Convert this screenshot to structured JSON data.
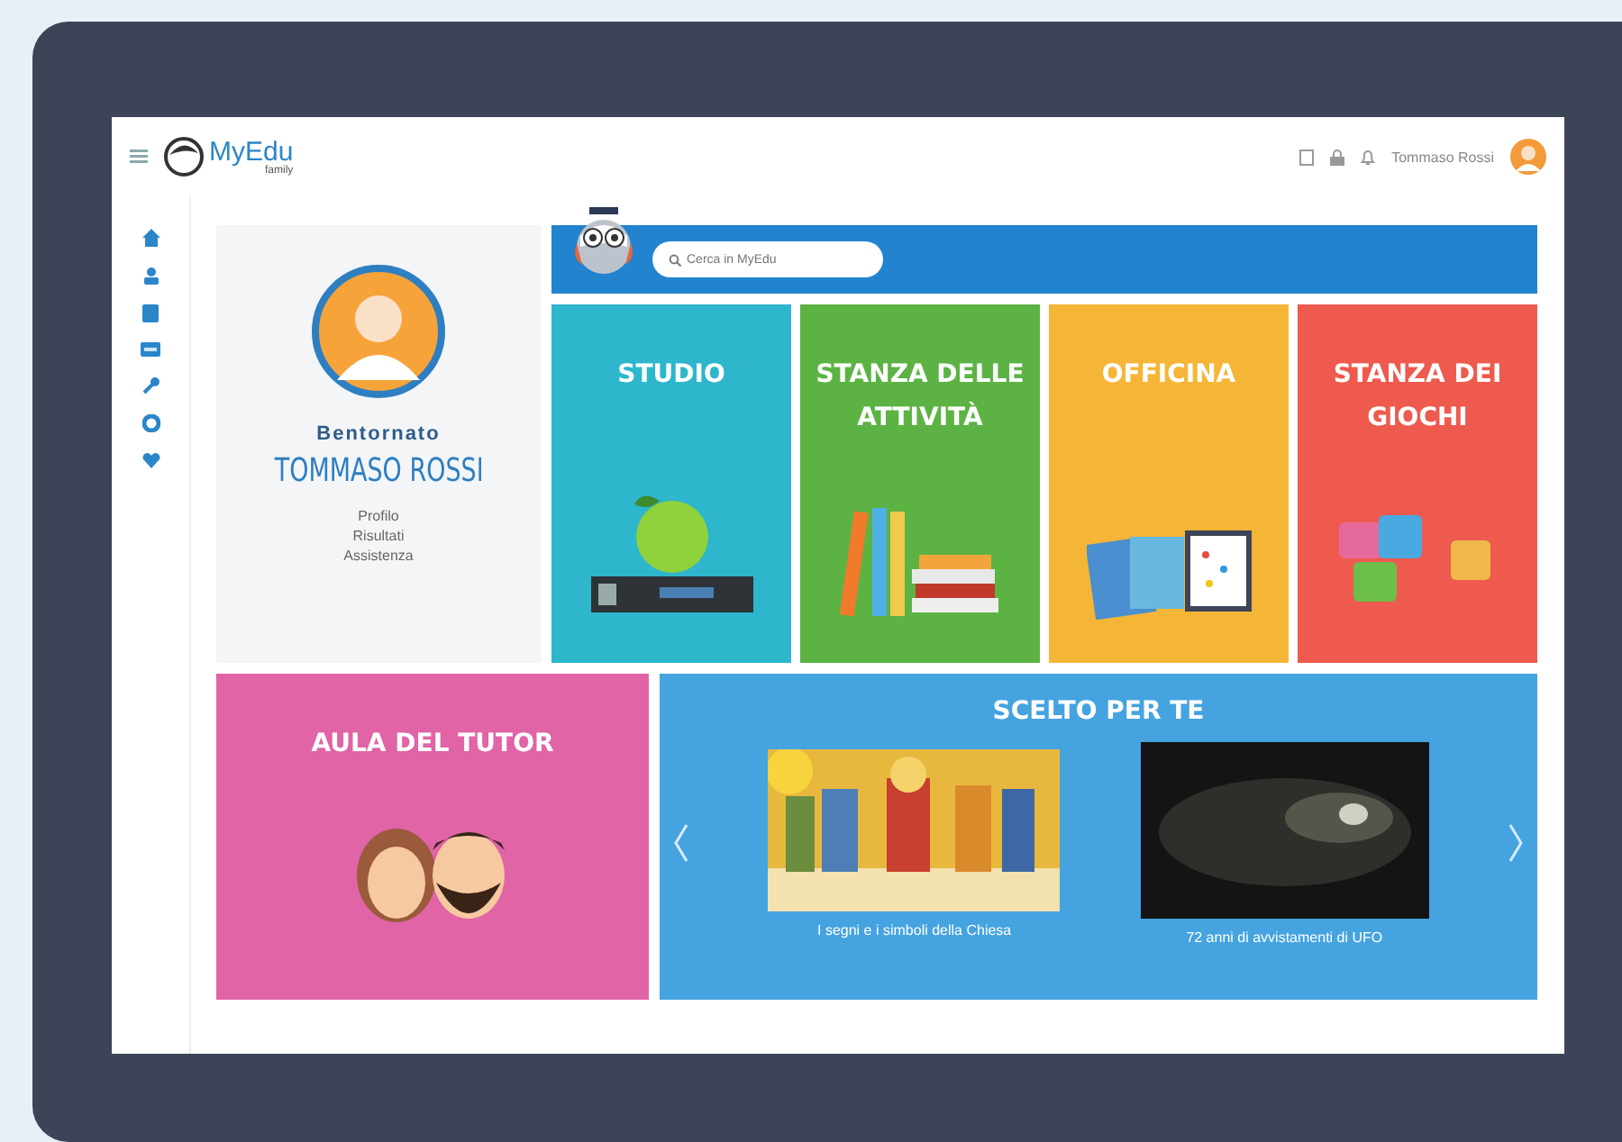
{
  "header": {
    "logo": "MyEdu",
    "logo_sub": "family",
    "user_name": "Tommaso Rossi"
  },
  "profile": {
    "greeting": "Bentornato",
    "name": "TOMMASO ROSSI",
    "links": [
      "Profilo",
      "Risultati",
      "Assistenza"
    ]
  },
  "search": {
    "placeholder": "Cerca in MyEdu"
  },
  "tiles": [
    {
      "title": "STUDIO",
      "color": "#2db6cc",
      "kind": "apple"
    },
    {
      "title": "STANZA DELLE ATTIVITÀ",
      "color": "#5cb344",
      "kind": "books"
    },
    {
      "title": "OFFICINA",
      "color": "#f5b637",
      "kind": "notebooks"
    },
    {
      "title": "STANZA DEI GIOCHI",
      "color": "#ee5a4e",
      "kind": "puzzle"
    }
  ],
  "tutor": {
    "title": "AULA DEL TUTOR",
    "color": "#e064a6"
  },
  "featured": {
    "title": "SCELTO PER TE",
    "items": [
      {
        "caption": "I segni e i simboli della Chiesa",
        "kind": "picture"
      },
      {
        "caption": "72 anni di avvistamenti di UFO",
        "kind": "picture"
      }
    ]
  }
}
